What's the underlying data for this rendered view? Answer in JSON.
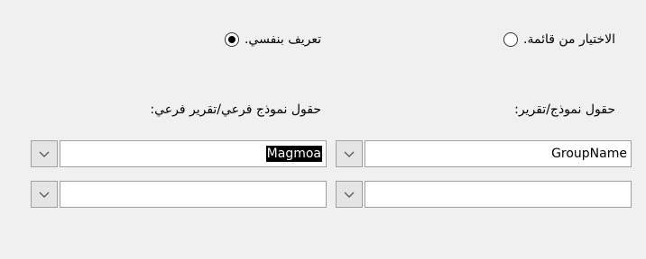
{
  "source": {
    "choose_from_list_label": "الاختيار من قائمة.",
    "define_myself_label": "تعريف بنفسي.",
    "selected": "define_myself"
  },
  "fields": {
    "report_label": "حقول نموذج/تقرير:",
    "subreport_label": "حقول نموذج فرعي/تقرير فرعي:",
    "rows": [
      {
        "report_field": "GroupName",
        "subreport_field": "Magmoa"
      },
      {
        "report_field": "",
        "subreport_field": ""
      }
    ]
  },
  "icons": {
    "dropdown": "chevron-down-icon"
  }
}
